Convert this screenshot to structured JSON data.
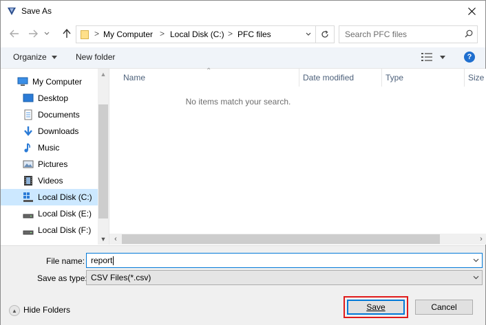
{
  "window": {
    "title": "Save As"
  },
  "address": {
    "crumbs": [
      "My Computer",
      "Local Disk (C:)",
      "PFC files"
    ],
    "separator": ">"
  },
  "search": {
    "placeholder": "Search PFC files"
  },
  "toolbar": {
    "organize_label": "Organize",
    "new_folder_label": "New folder",
    "help_label": "?"
  },
  "nav": {
    "items": [
      {
        "label": "My Computer",
        "icon": "computer-icon",
        "selected": false
      },
      {
        "label": "Desktop",
        "icon": "desktop-icon",
        "selected": false
      },
      {
        "label": "Documents",
        "icon": "documents-icon",
        "selected": false
      },
      {
        "label": "Downloads",
        "icon": "downloads-icon",
        "selected": false
      },
      {
        "label": "Music",
        "icon": "music-icon",
        "selected": false
      },
      {
        "label": "Pictures",
        "icon": "pictures-icon",
        "selected": false
      },
      {
        "label": "Videos",
        "icon": "videos-icon",
        "selected": false
      },
      {
        "label": "Local Disk (C:)",
        "icon": "windows-drive-icon",
        "selected": true
      },
      {
        "label": "Local Disk (E:)",
        "icon": "drive-icon",
        "selected": false
      },
      {
        "label": "Local Disk (F:)",
        "icon": "drive-icon",
        "selected": false
      }
    ]
  },
  "filelist": {
    "columns": [
      "Name",
      "Date modified",
      "Type",
      "Size"
    ],
    "empty_message": "No items match your search."
  },
  "form": {
    "file_name_label": "File name:",
    "file_name_value": "report",
    "save_type_label": "Save as type:",
    "save_type_value": "CSV Files(*.csv)"
  },
  "footer": {
    "hide_folders_label": "Hide Folders",
    "save_label": "Save",
    "cancel_label": "Cancel"
  },
  "colors": {
    "accent": "#0078d7",
    "selection": "#cce8ff",
    "highlight": "#e01a1a",
    "help": "#1f6fcf"
  }
}
